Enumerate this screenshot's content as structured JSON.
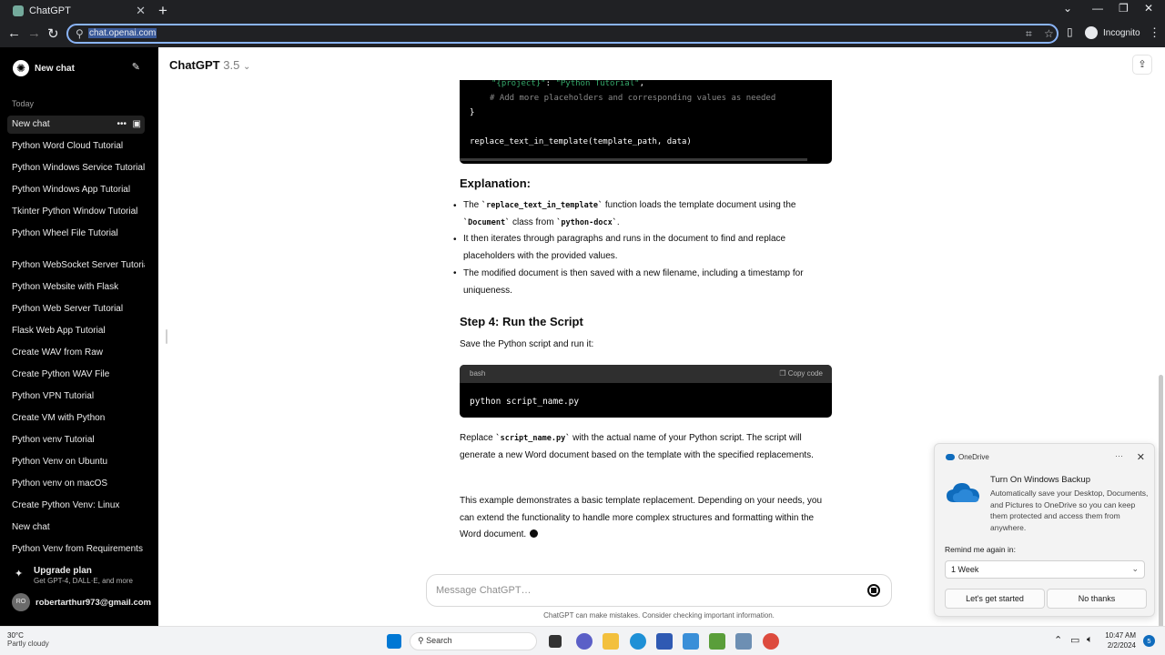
{
  "browser": {
    "tab_title": "ChatGPT",
    "url": "chat.openai.com",
    "profile_label": "Incognito",
    "controls": {
      "minimize": "⌄",
      "back": "←",
      "forward": "→",
      "reload": "↻"
    }
  },
  "sidebar": {
    "new_chat_label": "New chat",
    "group_today": "Today",
    "items": [
      {
        "label": "New chat"
      },
      {
        "label": "Python Word Cloud Tutorial"
      },
      {
        "label": "Python Windows Service Tutorial"
      },
      {
        "label": "Python Windows App Tutorial"
      },
      {
        "label": "Tkinter Python Window Tutorial"
      },
      {
        "label": "Python Wheel File Tutorial"
      },
      {
        "label": "Python WebSocket Server Tutorial"
      },
      {
        "label": "Python Website with Flask"
      },
      {
        "label": "Python Web Server Tutorial"
      },
      {
        "label": "Flask Web App Tutorial"
      },
      {
        "label": "Create WAV from Raw"
      },
      {
        "label": "Create Python WAV File"
      },
      {
        "label": "Python VPN Tutorial"
      },
      {
        "label": "Create VM with Python"
      },
      {
        "label": "Python venv Tutorial"
      },
      {
        "label": "Python Venv on Ubuntu"
      },
      {
        "label": "Python venv on macOS"
      },
      {
        "label": "Create Python Venv: Linux"
      },
      {
        "label": "New chat"
      },
      {
        "label": "Python Venv from Requirements"
      }
    ],
    "upgrade_title": "Upgrade plan",
    "upgrade_sub": "Get GPT-4, DALL·E, and more",
    "avatar_initials": "RO",
    "email": "robertarthur973@gmail.com"
  },
  "header": {
    "model_name": "ChatGPT",
    "model_version": "3.5",
    "chevron": "⌄"
  },
  "content": {
    "code1_lines": {
      "l1_key": "\"{project}\"",
      "l1_sep": ": ",
      "l1_val": "\"Python Tutorial\"",
      "l1_end": ",",
      "l2": "# Add more placeholders and corresponding values as needed",
      "l3": "}",
      "l4": "replace_text_in_template(template_path, data)"
    },
    "explanation_heading": "Explanation:",
    "bullet1": {
      "p1": "The ",
      "c1": "`replace_text_in_template`",
      "p2": " function loads the template document using the ",
      "c2": "`Document`",
      "p3": " class from ",
      "c3": "`python-docx`",
      "p4": "."
    },
    "bullet2": "It then iterates through paragraphs and runs in the document to find and replace placeholders with the provided values.",
    "bullet3": "The modified document is then saved with a new filename, including a timestamp for uniqueness.",
    "step4_heading": "Step 4: Run the Script",
    "step4_intro": "Save the Python script and run it:",
    "code2": {
      "lang": "bash",
      "copy_label": "Copy code",
      "command": "python script_name.py"
    },
    "replace_para": {
      "p1": "Replace ",
      "c1": "`script_name.py`",
      "p2": " with the actual name of your Python script. The script will generate a new Word document based on the template with the specified replacements."
    },
    "final_para": "This example demonstrates a basic template replacement. Depending on your needs, you can extend the functionality to handle more complex structures and formatting within the Word document."
  },
  "composer": {
    "placeholder": "Message ChatGPT…",
    "disclaimer": "ChatGPT can make mistakes. Consider checking important information."
  },
  "toast": {
    "app_name": "OneDrive",
    "title": "Turn On Windows Backup",
    "body": "Automatically save your Desktop, Documents, and Pictures to OneDrive so you can keep them protected and access them from anywhere.",
    "remind_label": "Remind me again in:",
    "remind_value": "1 Week",
    "primary_button": "Let's get started",
    "secondary_button": "No thanks"
  },
  "taskbar": {
    "temperature": "30°C",
    "condition": "Partly cloudy",
    "search_label": "Search",
    "time": "10:47 AM",
    "date": "2/2/2024",
    "notification_count": "5"
  }
}
